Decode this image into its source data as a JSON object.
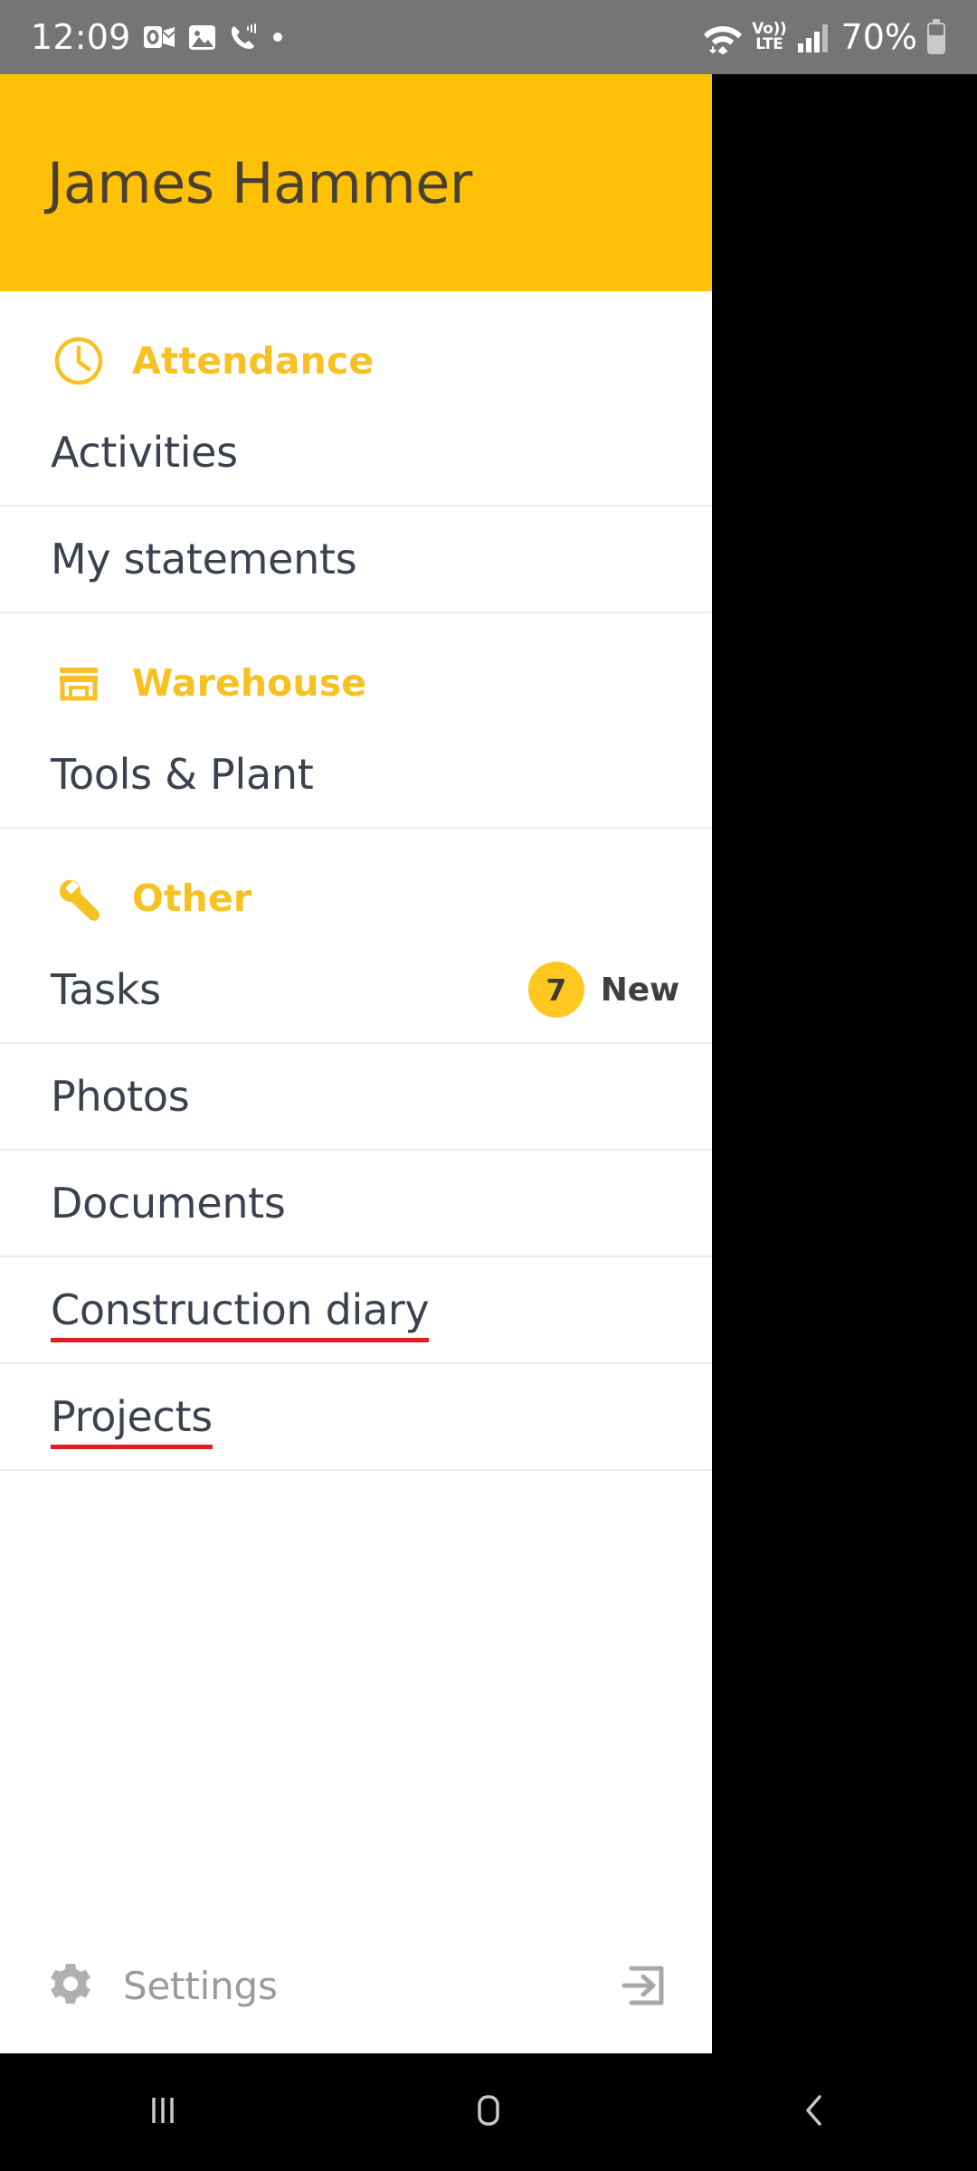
{
  "status_bar": {
    "time": "12:09",
    "battery_percent": "70%",
    "volte_top": "Vo))",
    "volte_bottom": "LTE",
    "left_icons": [
      "outlook-icon",
      "photos-icon",
      "phone-call-icon",
      "dot-icon"
    ],
    "right_icons": [
      "wifi-icon",
      "volte-icon",
      "signal-bars-icon",
      "battery-icon"
    ]
  },
  "drawer": {
    "header": {
      "username": "James Hammer",
      "background_color": "#FFC107",
      "text_color": "#4a4032"
    },
    "accent_color": "#F7C122",
    "spellcheck_underline_color": "#e02020",
    "sections": [
      {
        "id": "attendance",
        "label": "Attendance",
        "icon": "clock-icon",
        "items": [
          {
            "label": "Activities",
            "spellcheck": false,
            "badge": null
          },
          {
            "label": "My statements",
            "spellcheck": false,
            "badge": null
          }
        ]
      },
      {
        "id": "warehouse",
        "label": "Warehouse",
        "icon": "storefront-icon",
        "items": [
          {
            "label": "Tools & Plant",
            "spellcheck": false,
            "badge": null
          }
        ]
      },
      {
        "id": "other",
        "label": "Other",
        "icon": "wrench-icon",
        "items": [
          {
            "label": "Tasks",
            "spellcheck": false,
            "badge": {
              "count": "7",
              "text": "New"
            }
          },
          {
            "label": "Photos",
            "spellcheck": false,
            "badge": null
          },
          {
            "label": "Documents",
            "spellcheck": false,
            "badge": null
          },
          {
            "label": "Construction diary",
            "spellcheck": true,
            "badge": null
          },
          {
            "label": "Projects",
            "spellcheck": true,
            "badge": null
          }
        ]
      }
    ],
    "footer": {
      "settings_label": "Settings",
      "settings_icon": "gear-icon",
      "logout_icon": "logout-arrow-icon",
      "text_color": "#9a9a9a"
    }
  },
  "navbar": {
    "recents_icon": "recents-bars-icon",
    "home_icon": "home-square-icon",
    "back_icon": "back-chevron-icon"
  }
}
